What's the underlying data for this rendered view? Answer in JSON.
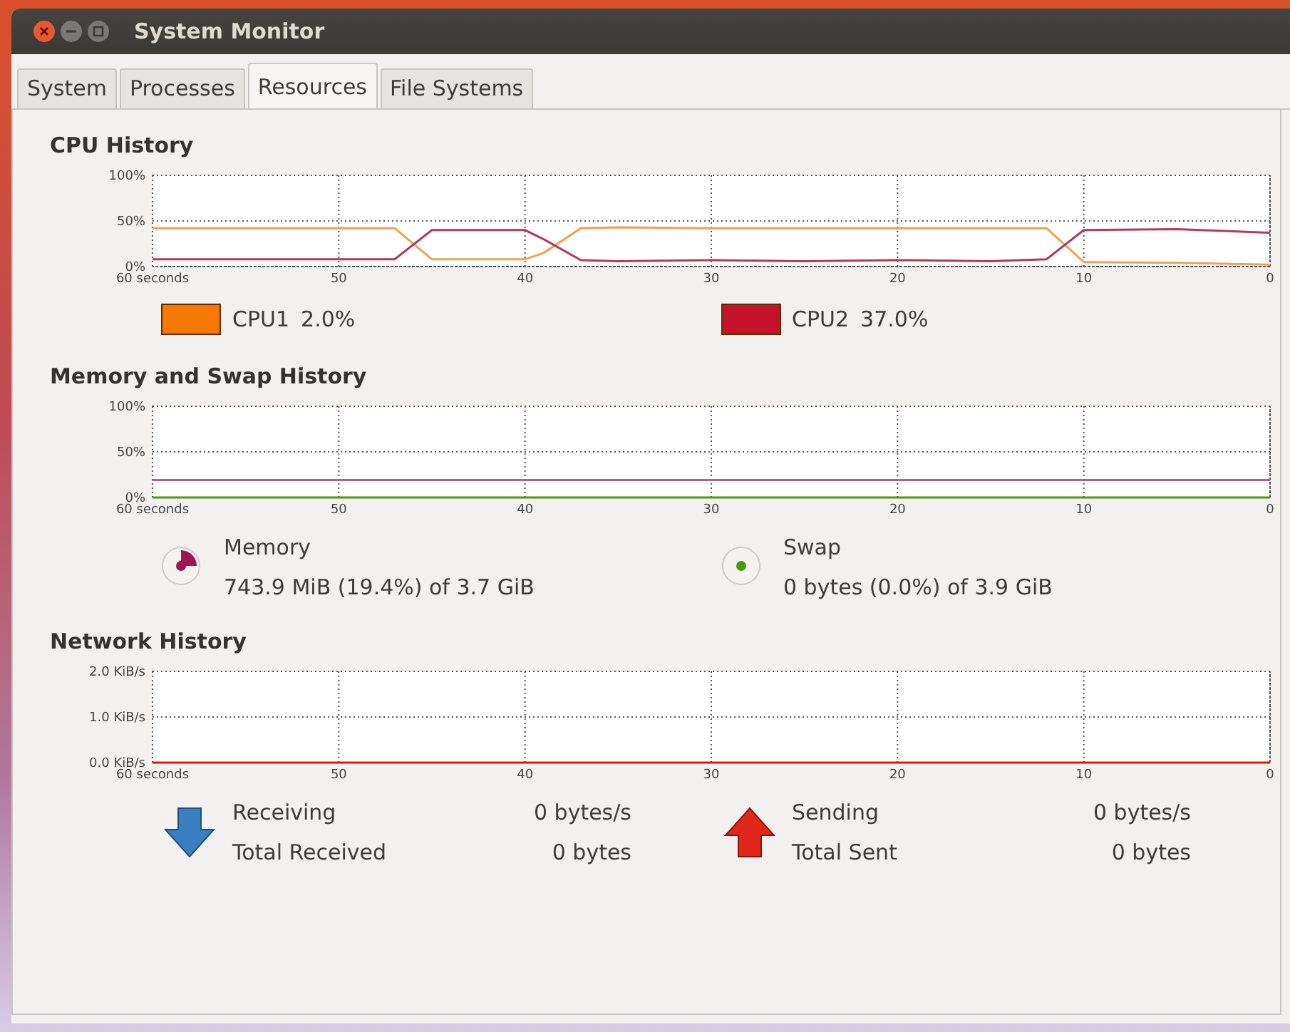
{
  "window": {
    "title": "System Monitor"
  },
  "tabs": [
    {
      "label": "System",
      "selected": false
    },
    {
      "label": "Processes",
      "selected": false
    },
    {
      "label": "Resources",
      "selected": true
    },
    {
      "label": "File Systems",
      "selected": false
    }
  ],
  "cpu": {
    "title": "CPU History",
    "chart_data": {
      "type": "line",
      "grid": true,
      "x": [
        60,
        55,
        50,
        47,
        45,
        40,
        39,
        37,
        35,
        30,
        25,
        20,
        15,
        12,
        10,
        5,
        0
      ],
      "xlim": [
        60,
        0
      ],
      "ylim": [
        0,
        100
      ],
      "xticks": [
        {
          "value": 60,
          "label": "60 seconds"
        },
        50,
        40,
        30,
        20,
        10,
        0
      ],
      "yticks": [
        {
          "value": 0,
          "label": "0%"
        },
        {
          "value": 50,
          "label": "50%"
        },
        {
          "value": 100,
          "label": "100%"
        }
      ],
      "series": [
        {
          "name": "CPU1",
          "color": "#f0a050",
          "values": [
            42,
            42,
            42,
            42,
            8,
            8,
            15,
            42,
            43,
            42,
            42,
            42,
            42,
            42,
            5,
            4,
            2
          ]
        },
        {
          "name": "CPU2",
          "color": "#b03a60",
          "values": [
            8,
            8,
            8,
            8,
            40,
            40,
            30,
            7,
            6,
            7,
            6,
            7,
            6,
            8,
            40,
            41,
            37
          ]
        }
      ]
    },
    "legend": [
      {
        "value": "2.0%",
        "color": "#f57900"
      },
      {
        "value": "37.0%",
        "color": "#c4122b"
      }
    ]
  },
  "memory": {
    "title": "Memory and Swap History",
    "chart_data": {
      "type": "line",
      "grid": true,
      "x": [
        60,
        0
      ],
      "xlim": [
        60,
        0
      ],
      "ylim": [
        0,
        100
      ],
      "xticks": [
        {
          "value": 60,
          "label": "60 seconds"
        },
        50,
        40,
        30,
        20,
        10,
        0
      ],
      "yticks": [
        {
          "value": 0,
          "label": "0%"
        },
        {
          "value": 50,
          "label": "50%"
        },
        {
          "value": 100,
          "label": "100%"
        }
      ],
      "series": [
        {
          "name": "Memory",
          "color": "#b0608a",
          "values": [
            19,
            19
          ]
        },
        {
          "name": "Swap",
          "color": "#4e9a06",
          "values": [
            0,
            0
          ]
        }
      ]
    },
    "items": [
      {
        "kind": "pie",
        "detail": "743.9 MiB (19.4%) of 3.7 GiB",
        "color": "#a0154f"
      },
      {
        "kind": "dot",
        "detail": "0 bytes (0.0%) of 3.9 GiB",
        "color": "#4e9a06"
      }
    ]
  },
  "network": {
    "title": "Network History",
    "chart_data": {
      "type": "line",
      "grid": true,
      "x": [
        60,
        0
      ],
      "xlim": [
        60,
        0
      ],
      "ylim": [
        0,
        2
      ],
      "xticks": [
        {
          "value": 60,
          "label": "60 seconds"
        },
        50,
        40,
        30,
        20,
        10,
        0
      ],
      "yticks": [
        {
          "value": 0,
          "label": "0.0 KiB/s"
        },
        {
          "value": 1,
          "label": "1.0 KiB/s"
        },
        {
          "value": 2,
          "label": "2.0 KiB/s"
        }
      ],
      "series": [
        {
          "name": "Sending",
          "color": "#cc2200",
          "values": [
            0,
            0
          ]
        }
      ]
    },
    "items": [
      {
        "kind": "down",
        "label": "Receiving",
        "value": "0 bytes/s",
        "total_label": "Total Received",
        "total_value": "0 bytes"
      },
      {
        "kind": "up",
        "value": "0 bytes/s",
        "total_label": "Total Sent",
        "total_value": "0 bytes"
      }
    ]
  }
}
